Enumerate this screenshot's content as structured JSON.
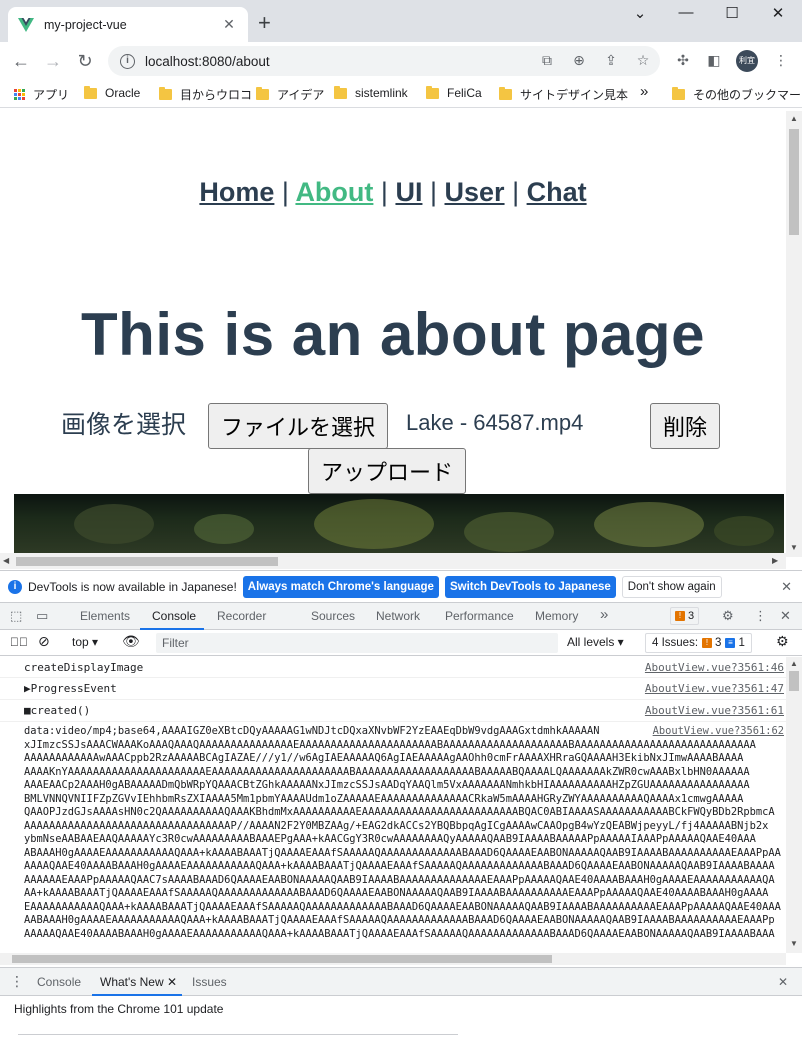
{
  "browser": {
    "tab_title": "my-project-vue",
    "tab_close": "✕",
    "new_tab": "+",
    "url": "localhost:8080/about",
    "window_controls": {
      "minimize": "—",
      "maximize": "☐",
      "close": "✕"
    },
    "avatar_text": "利宜"
  },
  "bookmarks": {
    "apps": "アプリ",
    "items": [
      "Oracle",
      "目からウロコ",
      "アイデア",
      "sistemlink",
      "FeliCa",
      "サイトデザイン見本"
    ],
    "more": "»",
    "other": "その他のブックマーク"
  },
  "page": {
    "nav": [
      "Home",
      "About",
      "UI",
      "User",
      "Chat"
    ],
    "nav_sep": "|",
    "title": "This is an about page",
    "select_label": "画像を選択",
    "file_button": "ファイルを選択",
    "file_name": "Lake - 64587.mp4",
    "delete_button": "削除",
    "upload_button": "アップロード"
  },
  "devtools": {
    "banner": {
      "text": "DevTools is now available in Japanese!",
      "btn_match": "Always match Chrome's language",
      "btn_switch": "Switch DevTools to Japanese",
      "btn_dont": "Don't show again"
    },
    "tabs": [
      "Elements",
      "Console",
      "Recorder",
      "Sources",
      "Network",
      "Performance",
      "Memory"
    ],
    "more_tabs": "»",
    "issue_badge_count": "3",
    "console_toolbar": {
      "context": "top",
      "filter_placeholder": "Filter",
      "levels": "All levels ▾",
      "issues_label": "4 Issues:",
      "issues_warn": "3",
      "issues_info": "1"
    },
    "logs": [
      {
        "msg": "createDisplayImage",
        "src": "AboutView.vue?3561:46"
      },
      {
        "msg": "▶ProgressEvent",
        "src": "AboutView.vue?3561:47"
      },
      {
        "msg": "■created()",
        "src": "AboutView.vue?3561:61"
      }
    ],
    "data_first": "data:video/mp4;base64,AAAAIGZ0eXBtcDQyAAAAAG1wNDJtcDQxaXNvbWF2YzEAAEqDbW9vdgAAAGxtdmhkAAAAAN",
    "data_src": "AboutView.vue?3561:62",
    "data_lines": [
      "xJImzcSSJsAAACWAAAKoAAAQAAAQAAAAAAAAAAAAAAAEAAAAAAAAAAAAAAAAAAAAAABAAAAAAAAAAAAAAAAAAAABAAAAAAAAAAAAAAAAAAAAAAAAAAAAA",
      "AAAAAAAAAAAAwAAACppb2RzAAAAABCAgIAZAE///y1//w6AgIAEAAAAAQ6AgIAEAAAAAgAAOhh0cmFrAAAAXHRraGQAAAAH3EkibNxJImwAAAABAAAA",
      "AAAAKnYAAAAAAAAAAAAAAAAAAAAAAEAAAAAAAAAAAAAAAAAAAAAABAAAAAAAAAAAAAAAAAAABAAAAABQAAAALQAAAAAAAkZWR0cwAAABxlbHN0AAAAAA",
      "AAAEAACp2AAAH0gABAAAAADmQbWRpYQAAACBtZGhkAAAAANxJImzcSSJsAADqYAAQlm5VxAAAAAAANmhkbHIAAAAAAAAAAHZpZGUAAAAAAAAAAAAAAAA",
      "BMLVNNQVNIIFZpZGVvIEhhbmRsZXIAAAA5Mm1pbmYAAAAUdm1oZAAAAAEAAAAAAAAAAAAAACRkaW5mAAAAHGRyZWYAAAAAAAAAAQAAAAx1cmwgAAAAA",
      "QAAOPJzdGJsAAAAsHN0c2QAAAAAAAAAAQAAAKBhdmMxAAAAAAAAAAEAAAAAAAAAAAAAAAAAAAAAAAAABQAC0ABIAAAASAAAAAAAAAAABCkFWQyBDb2RpbmcA",
      "AAAAAAAAAAAAAAAAAAAAAAAAAAAAAAAAAP//AAAAN2F2Y0MBZAAg/+EAG2dkACCs2YBQBbpqAgICgAAAAwCAAOpgB4wYzQEABWjpeyyL/fj4AAAAABNjb2x",
      "ybmNseAABAAEAAQAAAAAYc3R0cwAAAAAAAAABAAAEPgAAA+kAACGgY3R0cwAAAAAAAAQyAAAAAQAAB9IAAAABAAAAAPpAAAAAIAAAPpAAAAAQAAE40AAA",
      "ABAAAH0gAAAAEAAAAAAAAAAAQAAA+kAAAABAAATjQAAAAEAAAfSAAAAAQAAAAAAAAAAAAABAAAD6QAAAAEAABONAAAAAQAAB9IAAAABAAAAAAAAAAEAAAPpAA",
      "AAAAQAAE40AAAABAAAH0gAAAAEAAAAAAAAAAAQAAA+kAAAABAAATjQAAAAEAAAfSAAAAAQAAAAAAAAAAAAABAAAD6QAAAAEAABONAAAAAQAAB9IAAAABAAAA",
      "AAAAAAEAAAPpAAAAAQAAC7sAAAABAAAD6QAAAAEAABONAAAAAQAAB9IAAAABAAAAAAAAAAAAAAEAAAPpAAAAAQAAE40AAAABAAAH0gAAAAEAAAAAAAAAAAQA",
      "AA+kAAAABAAATjQAAAAEAAAfSAAAAAQAAAAAAAAAAAAABAAAD6QAAAAEAABONAAAAAQAAB9IAAAABAAAAAAAAAAEAAAPpAAAAAQAAE40AAAABAAAH0gAAAA",
      "EAAAAAAAAAAAQAAA+kAAAABAAATjQAAAAEAAAfSAAAAAQAAAAAAAAAAAAABAAAD6QAAAAEAABONAAAAAQAAB9IAAAABAAAAAAAAAAEAAAPpAAAAAQAAE40AAA",
      "AABAAAH0gAAAAEAAAAAAAAAAAQAAA+kAAAABAAATjQAAAAEAAAfSAAAAAQAAAAAAAAAAAAABAAAD6QAAAAEAABONAAAAAQAAB9IAAAABAAAAAAAAAAEAAAPp",
      "AAAAAQAAE40AAAABAAAH0gAAAAEAAAAAAAAAAAQAAA+kAAAABAAATjQAAAAEAAAfSAAAAAQAAAAAAAAAAAAABAAAD6QAAAAEAABONAAAAAQAAB9IAAAABAAA"
    ],
    "drawer": {
      "tabs": [
        "Console",
        "What's New",
        "Issues"
      ],
      "close": "✕",
      "highlights": "Highlights from the Chrome 101 update"
    }
  }
}
